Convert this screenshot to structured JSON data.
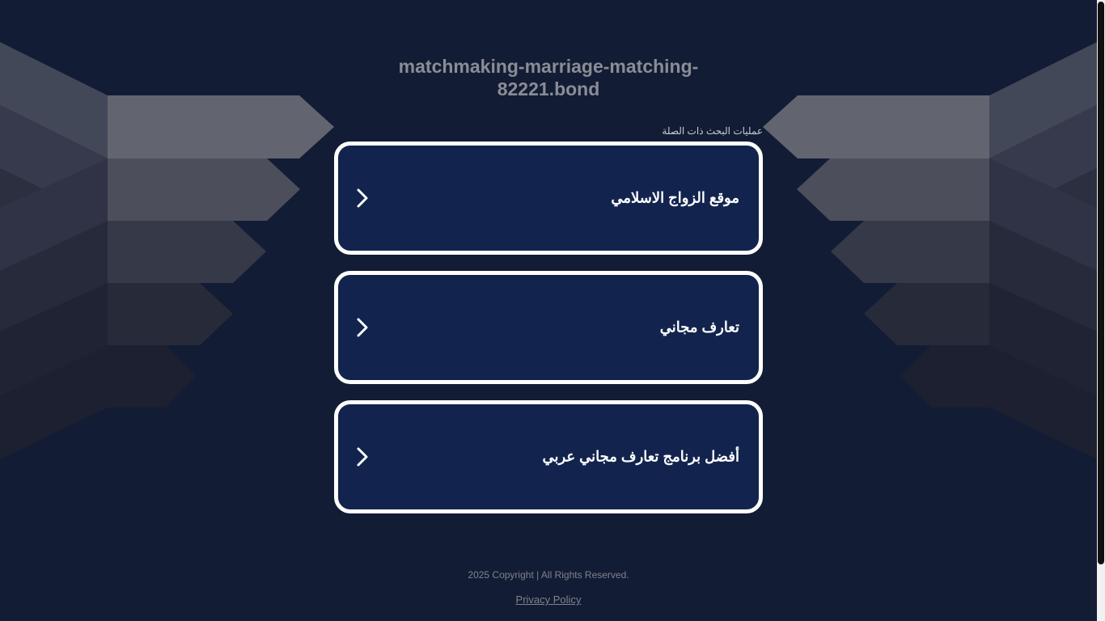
{
  "domain_title": "matchmaking-marriage-matching-82221.bond",
  "related_label": "عمليات البحث ذات الصلة",
  "cards": [
    {
      "label": "موقع الزواج الاسلامي",
      "icon": "chevron-right-icon"
    },
    {
      "label": "تعارف مجاني",
      "icon": "chevron-right-icon"
    },
    {
      "label": "أفضل برنامج تعارف مجاني عربي",
      "icon": "chevron-right-icon"
    }
  ],
  "footer": {
    "copyright": "2025 Copyright | All Rights Reserved.",
    "privacy": "Privacy Policy"
  },
  "colors": {
    "background": "#131c35",
    "card": "#12244e",
    "card_border": "#ffffff",
    "muted_text": "#80838c"
  }
}
